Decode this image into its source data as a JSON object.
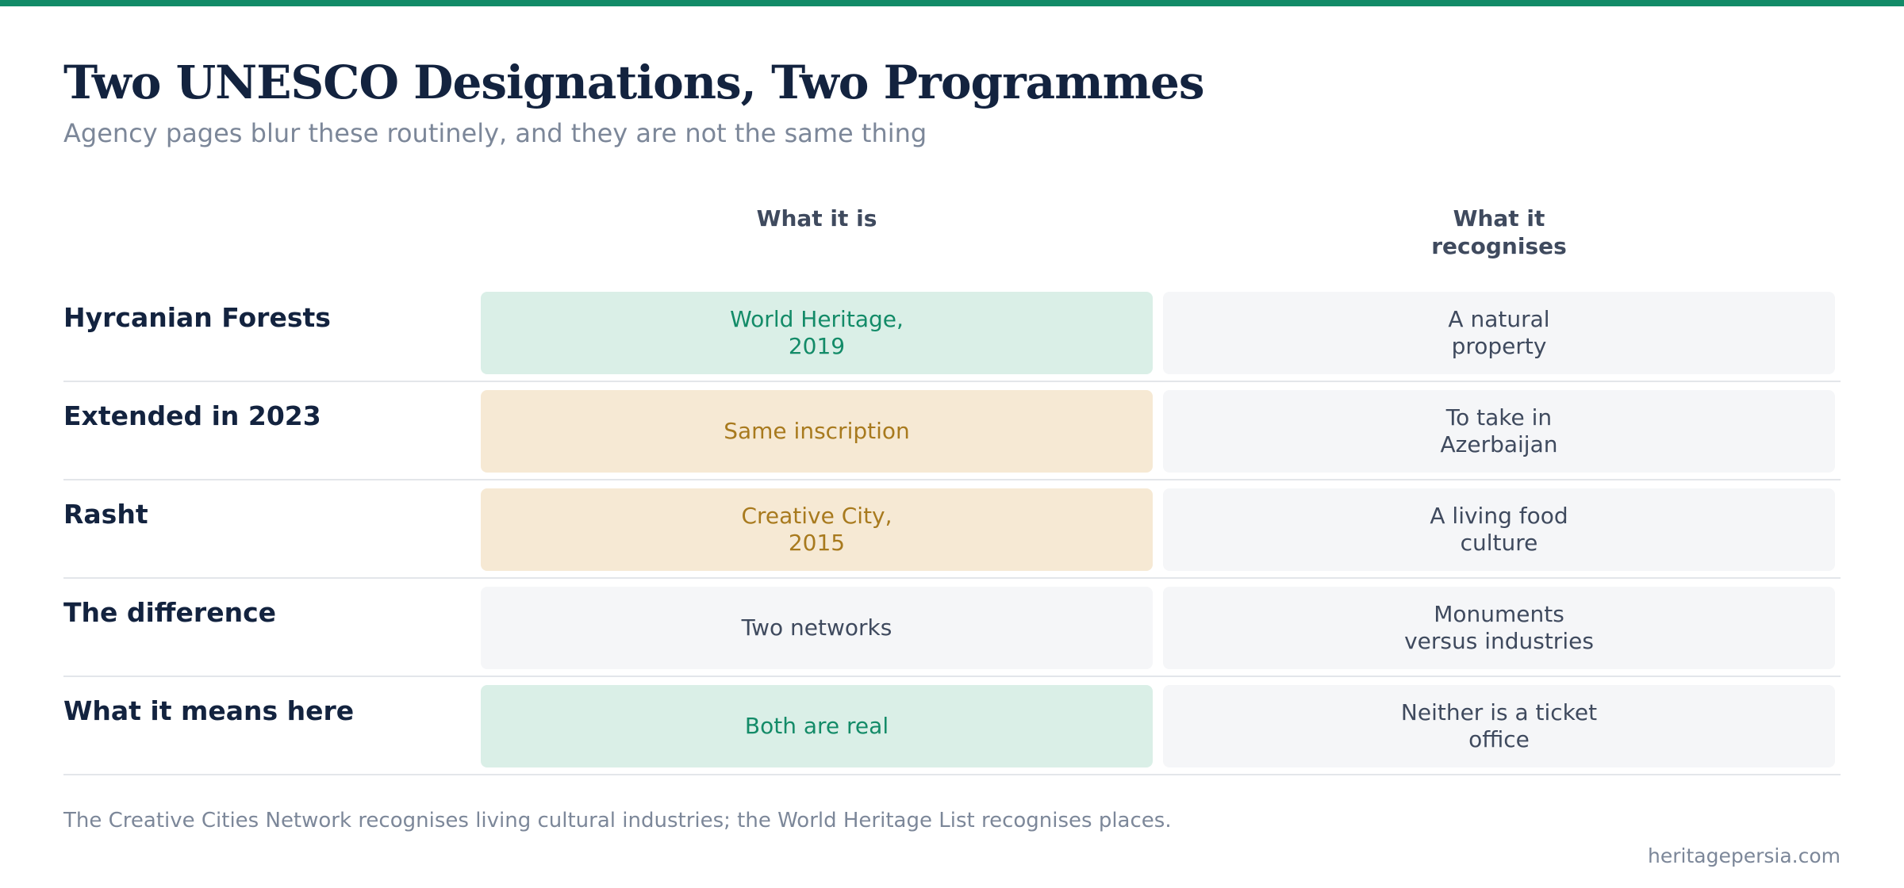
{
  "colors": {
    "accent_bar": "#138b68",
    "title": "#13233f",
    "muted": "#7c8799",
    "green_bg": "#daefe7",
    "green_text": "#138b68",
    "amber_bg": "#f6e9d4",
    "amber_text": "#a87a1e",
    "neutral_bg": "#f5f6f8",
    "neutral_text": "#3f4a5e"
  },
  "title": "Two UNESCO Designations, Two Programmes",
  "subtitle": "Agency pages blur these routinely, and they are not the same thing",
  "table": {
    "columns": [
      "What it is",
      "What it recognises"
    ],
    "rows": [
      {
        "label": "Hyrcanian Forests",
        "what_it_is": "World Heritage, 2019",
        "what_it_is_tone": "green",
        "recognises": "A natural property"
      },
      {
        "label": "Extended in 2023",
        "what_it_is": "Same inscription",
        "what_it_is_tone": "amber",
        "recognises": "To take in Azerbaijan"
      },
      {
        "label": "Rasht",
        "what_it_is": "Creative City, 2015",
        "what_it_is_tone": "amber",
        "recognises": "A living food culture"
      },
      {
        "label": "The difference",
        "what_it_is": "Two networks",
        "what_it_is_tone": "neutral",
        "recognises": "Monuments versus industries"
      },
      {
        "label": "What it means here",
        "what_it_is": "Both are real",
        "what_it_is_tone": "green",
        "recognises": "Neither is a ticket office"
      }
    ]
  },
  "footnote": "The Creative Cities Network recognises living cultural industries; the World Heritage List recognises places.",
  "credit": "heritagepersia.com"
}
